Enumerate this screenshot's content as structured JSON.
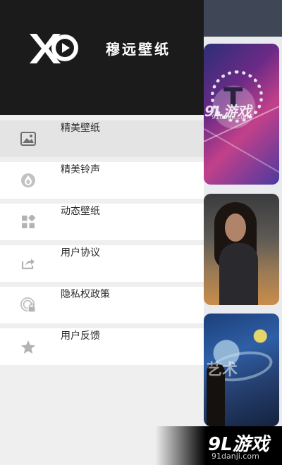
{
  "drawer": {
    "brand": "穆远壁纸",
    "items": [
      {
        "label": "精美壁纸",
        "icon": "image-icon",
        "active": true
      },
      {
        "label": "精美铃声",
        "icon": "sound-drop-icon",
        "active": false
      },
      {
        "label": "动态壁纸",
        "icon": "widgets-icon",
        "active": false
      },
      {
        "label": "用户协议",
        "icon": "share-icon",
        "active": false
      },
      {
        "label": "隐私权政策",
        "icon": "privacy-shield-icon",
        "active": false
      },
      {
        "label": "用户反馈",
        "icon": "star-icon",
        "active": false
      }
    ]
  },
  "background": {
    "watermark": "9L游戏",
    "watermark_url": "91danji.com",
    "card_text": "艺术"
  },
  "corner_watermark": {
    "logo": "9L游戏",
    "url": "91danji.com"
  },
  "colors": {
    "header_bg": "#1b1b1b",
    "drawer_bg": "#efefef",
    "active_item_bg": "#e4e4e4",
    "icon_gray": "#b3b3b3"
  }
}
